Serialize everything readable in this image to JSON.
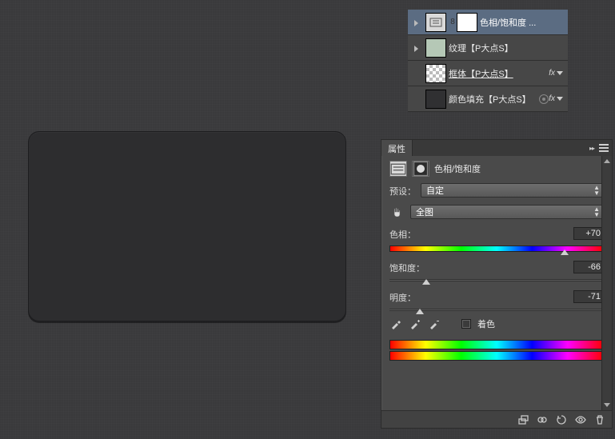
{
  "layers": {
    "items": [
      {
        "name": "色相/饱和度 ...",
        "selected": true,
        "hasToggle": true,
        "thumbs": [
          "adj",
          "mask"
        ],
        "link": "8",
        "fx": false
      },
      {
        "name": "纹理【P大点S】",
        "selected": false,
        "hasToggle": true,
        "thumbs": [
          "tex"
        ],
        "fx": false
      },
      {
        "name": "框体【P大点S】",
        "selected": false,
        "hasToggle": false,
        "thumbs": [
          "trans"
        ],
        "fx": true,
        "underline": true
      },
      {
        "name": "颜色填充【P大点S】",
        "selected": false,
        "hasToggle": false,
        "thumbs": [
          "solid"
        ],
        "fx": true,
        "eye": true
      }
    ]
  },
  "props": {
    "panel_title": "属性",
    "adj_title": "色相/饱和度",
    "preset_label": "预设：",
    "preset_value": "自定",
    "channel_value": "全图",
    "hue_label": "色相：",
    "hue_value": "+70",
    "hue_pos_pct": 82,
    "sat_label": "饱和度：",
    "sat_value": "-66",
    "sat_pos_pct": 17,
    "lig_label": "明度：",
    "lig_value": "-71",
    "lig_pos_pct": 14,
    "colorize_label": "着色"
  }
}
